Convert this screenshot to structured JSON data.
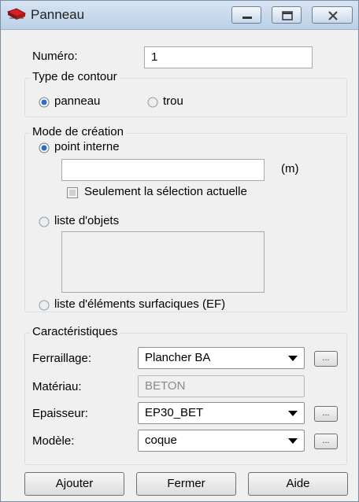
{
  "window": {
    "title": "Panneau"
  },
  "numero": {
    "label": "Numéro:",
    "value": "1"
  },
  "type_contour": {
    "title": "Type de contour",
    "options": [
      {
        "label": "panneau",
        "checked": true
      },
      {
        "label": "trou",
        "checked": false
      }
    ]
  },
  "mode_creation": {
    "title": "Mode de création",
    "point_interne": {
      "label": "point interne",
      "checked": true
    },
    "point_value": "",
    "unit": "(m)",
    "selection_checkbox": {
      "label": "Seulement la sélection actuelle",
      "checked": false
    },
    "liste_objets": {
      "label": "liste d'objets",
      "checked": false
    },
    "liste_elements": {
      "label": "liste d'éléments surfaciques (EF)",
      "checked": false
    }
  },
  "caracteristiques": {
    "title": "Caractéristiques",
    "ferraillage": {
      "label": "Ferraillage:",
      "value": "Plancher BA"
    },
    "materiau": {
      "label": "Matériau:",
      "value": "BETON"
    },
    "epaisseur": {
      "label": "Epaisseur:",
      "value": "EP30_BET"
    },
    "modele": {
      "label": "Modèle:",
      "value": "coque"
    },
    "ellipsis": "..."
  },
  "buttons": {
    "add": "Ajouter",
    "close": "Fermer",
    "help": "Aide"
  }
}
